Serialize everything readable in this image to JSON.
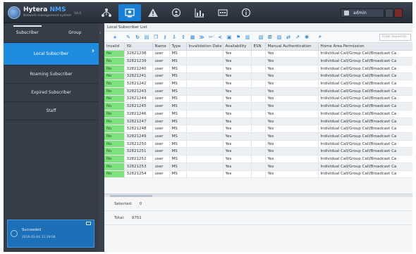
{
  "app": {
    "logo_title_prefix": "Hytera",
    "logo_title_suffix": "NMS",
    "logo_subtitle": "Network management system",
    "version": "V4.0"
  },
  "nav": {
    "icons": [
      "topology-icon",
      "subscriber-icon",
      "alarm-icon",
      "security-icon",
      "statistics-icon",
      "terminal-icon",
      "info-icon"
    ],
    "active_index": 1
  },
  "user": {
    "name": "admin"
  },
  "left_panel": {
    "tabs": [
      "Subscriber",
      "Group"
    ],
    "items": [
      {
        "label": "Local Subscriber",
        "active": true
      },
      {
        "label": "Roaming Subscriber",
        "active": false
      },
      {
        "label": "Expired Subscriber",
        "active": false
      },
      {
        "label": "Staff",
        "active": false
      }
    ],
    "status": {
      "title": "Succeeded",
      "time": "2016-02-04 11:29:04"
    }
  },
  "main": {
    "title": "Local Subscriber List",
    "search_placeholder": "Enter keywords",
    "columns": [
      "Invalid",
      "ISI",
      "Name",
      "Type",
      "Invalidation Date",
      "Availability",
      "ESN",
      "Manual Authentication",
      "Home Area Permission"
    ],
    "rows": [
      [
        "No",
        "32821238",
        "user",
        "MS",
        "",
        "Yes",
        "",
        "Yes",
        "Individual Call/Group Call/Broadcast Ca"
      ],
      [
        "No",
        "32821239",
        "user",
        "MS",
        "",
        "Yes",
        "",
        "Yes",
        "Individual Call/Group Call/Broadcast Ca"
      ],
      [
        "No",
        "32821240",
        "user",
        "MS",
        "",
        "Yes",
        "",
        "Yes",
        "Individual Call/Group Call/Broadcast Ca"
      ],
      [
        "No",
        "32821241",
        "user",
        "MS",
        "",
        "Yes",
        "",
        "Yes",
        "Individual Call/Group Call/Broadcast Ca"
      ],
      [
        "No",
        "32821242",
        "user",
        "MS",
        "",
        "Yes",
        "",
        "Yes",
        "Individual Call/Group Call/Broadcast Ca"
      ],
      [
        "No",
        "32821243",
        "user",
        "MS",
        "",
        "Yes",
        "",
        "Yes",
        "Individual Call/Group Call/Broadcast Ca"
      ],
      [
        "No",
        "32821244",
        "user",
        "MS",
        "",
        "Yes",
        "",
        "Yes",
        "Individual Call/Group Call/Broadcast Ca"
      ],
      [
        "No",
        "32821245",
        "user",
        "MS",
        "",
        "Yes",
        "",
        "Yes",
        "Individual Call/Group Call/Broadcast Ca"
      ],
      [
        "No",
        "32821246",
        "user",
        "MS",
        "",
        "Yes",
        "",
        "Yes",
        "Individual Call/Group Call/Broadcast Ca"
      ],
      [
        "No",
        "32821247",
        "user",
        "MS",
        "",
        "Yes",
        "",
        "Yes",
        "Individual Call/Group Call/Broadcast Ca"
      ],
      [
        "No",
        "32821248",
        "user",
        "MS",
        "",
        "Yes",
        "",
        "Yes",
        "Individual Call/Group Call/Broadcast Ca"
      ],
      [
        "No",
        "32821249",
        "user",
        "MS",
        "",
        "Yes",
        "",
        "Yes",
        "Individual Call/Group Call/Broadcast Ca"
      ],
      [
        "No",
        "32821250",
        "user",
        "MS",
        "",
        "Yes",
        "",
        "Yes",
        "Individual Call/Group Call/Broadcast Ca"
      ],
      [
        "No",
        "32821251",
        "user",
        "MS",
        "",
        "Yes",
        "",
        "Yes",
        "Individual Call/Group Call/Broadcast Ca"
      ],
      [
        "No",
        "32821252",
        "user",
        "MS",
        "",
        "Yes",
        "",
        "Yes",
        "Individual Call/Group Call/Broadcast Ca"
      ],
      [
        "No",
        "32821253",
        "user",
        "MS",
        "",
        "Yes",
        "",
        "Yes",
        "Individual Call/Group Call/Broadcast Ca"
      ],
      [
        "No",
        "32821254",
        "user",
        "MS",
        "",
        "Yes",
        "",
        "Yes",
        "Individual Call/Group Call/Broadcast Ca"
      ]
    ],
    "selected_label": "Selected:",
    "selected_value": "0",
    "total_label": "Total:",
    "total_value": "9751"
  },
  "colors": {
    "accent": "#1f8ce0",
    "invalid_no_bg": "#7fe07f",
    "dark_bg": "#2c3440"
  }
}
